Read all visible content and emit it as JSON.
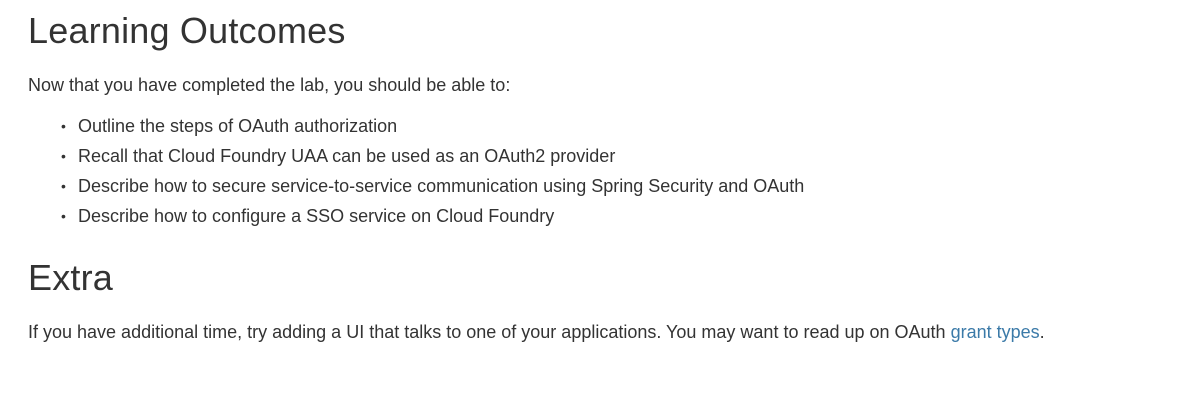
{
  "learning": {
    "heading": "Learning Outcomes",
    "intro": "Now that you have completed the lab, you should be able to:",
    "items": [
      {
        "bullet": "•",
        "text": "Outline the steps of OAuth authorization"
      },
      {
        "bullet": "•",
        "text": "Recall that Cloud Foundry UAA can be used as an OAuth2 provider"
      },
      {
        "bullet": "•",
        "text": "Describe how to secure service-to-service communication using Spring Security and OAuth"
      },
      {
        "bullet": "•",
        "text": "Describe how to configure a SSO service on Cloud Foundry"
      }
    ]
  },
  "extra": {
    "heading": "Extra",
    "text_before_link": "If you have additional time, try adding a UI that talks to one of your applications. You may want to read up on OAuth ",
    "link_text": "grant types",
    "text_after_link": ".",
    "link_color": "#3b7aa8"
  }
}
